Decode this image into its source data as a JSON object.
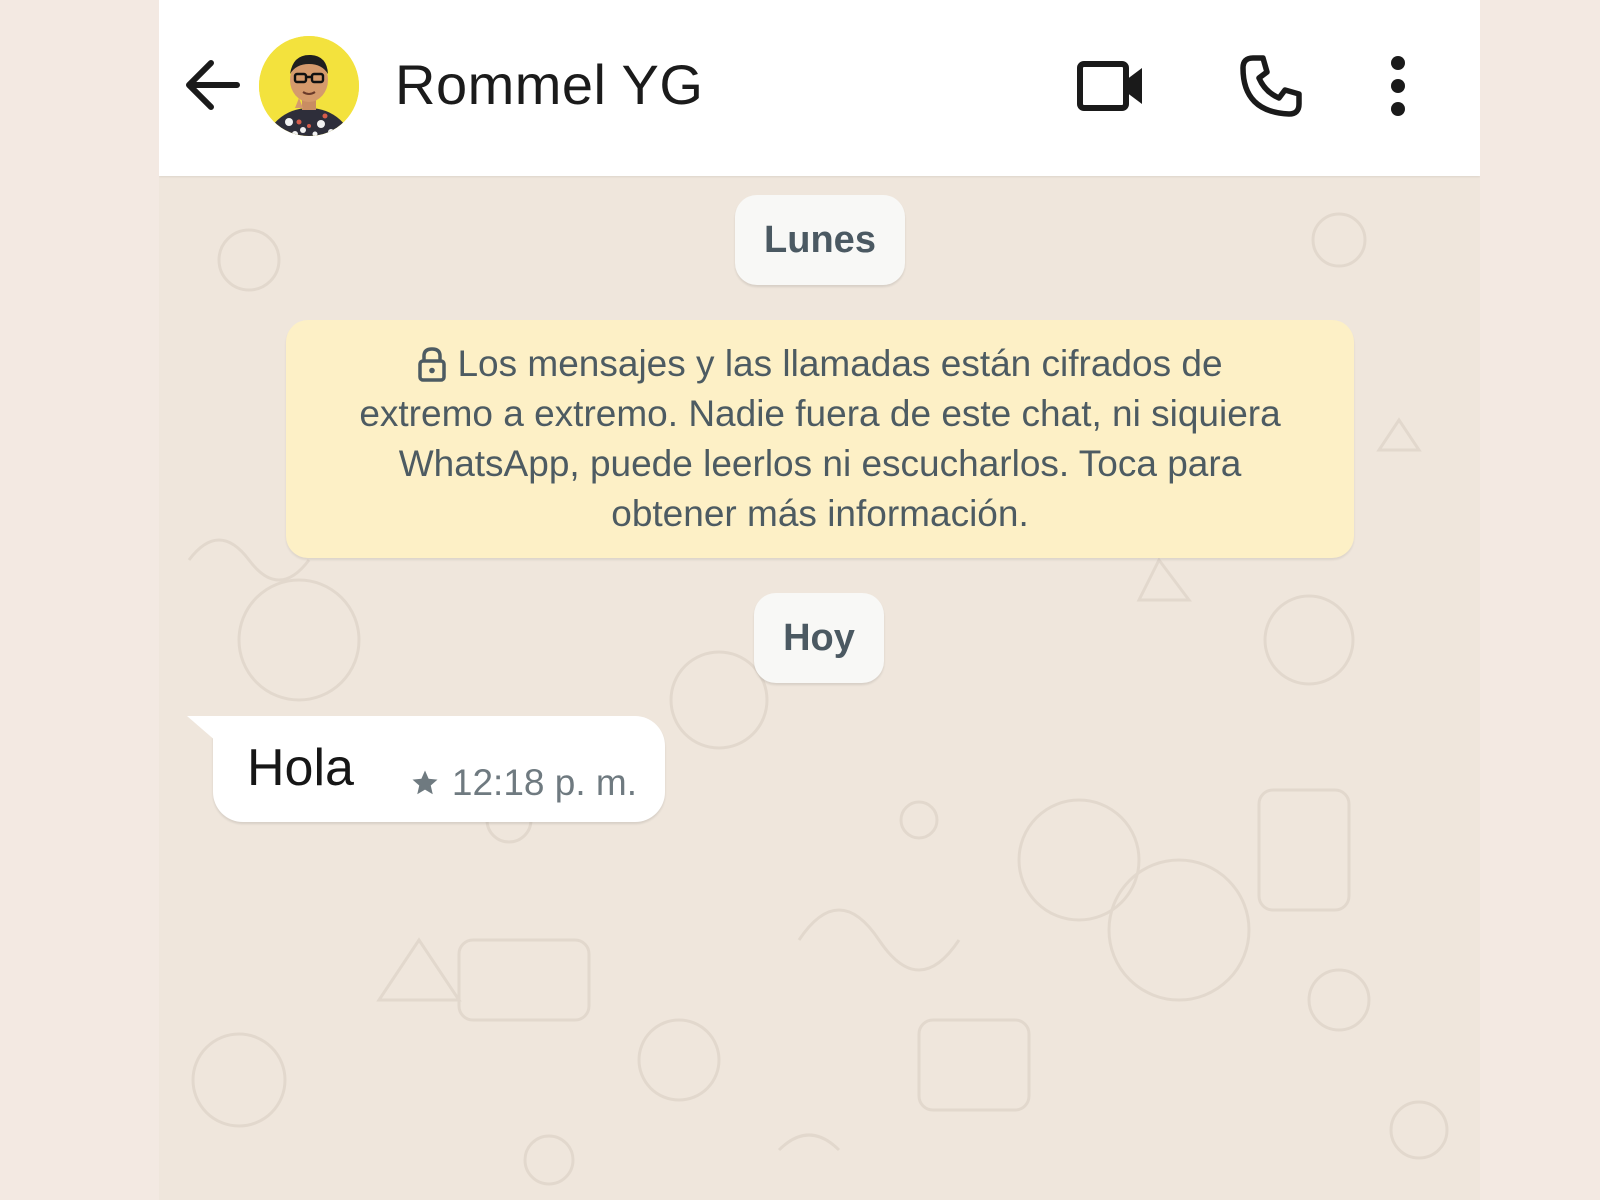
{
  "header": {
    "contact_name": "Rommel YG",
    "icons": {
      "back": "arrow-left-icon",
      "avatar": "contact-avatar",
      "video": "video-camera-icon",
      "call": "phone-icon",
      "more": "more-vert-icon"
    }
  },
  "chat": {
    "date_chip_1": "Lunes",
    "encryption_notice": "Los mensajes y las llamadas están cifrados de extremo a extremo. Nadie fuera de este chat, ni siquiera WhatsApp, puede leerlos ni escucharlos. Toca para obtener más información.",
    "date_chip_2": "Hoy",
    "messages": [
      {
        "text": "Hola",
        "time": "12:18 p. m.",
        "starred": true,
        "direction": "incoming"
      }
    ]
  },
  "colors": {
    "header_bg": "#ffffff",
    "chat_bg": "#efe6dc",
    "notice_bg": "#fdf0c6",
    "chip_bg": "#f8f8f6",
    "bubble_bg": "#ffffff"
  }
}
